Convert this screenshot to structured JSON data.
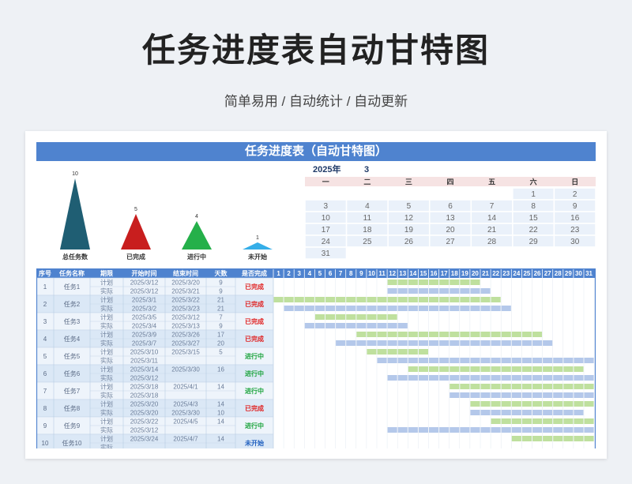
{
  "page": {
    "title": "任务进度表自动甘特图",
    "subtitle": "简单易用 / 自动统计 / 自动更新",
    "banner": "任务进度表（自动甘特图）"
  },
  "colors": {
    "banner": "#4f83cf",
    "table_header": "#4f83cf",
    "plan_bar": "#bfe09e",
    "actual_bar": "#b4c8ea",
    "status_done": "#e02020",
    "status_doing": "#1aa33b",
    "status_notstarted": "#1f5fbf"
  },
  "chart_data": {
    "type": "bar",
    "categories": [
      "总任务数",
      "已完成",
      "进行中",
      "未开始"
    ],
    "values": [
      10,
      5,
      4,
      1
    ],
    "colors": [
      "#1f5e73",
      "#c81e1e",
      "#25b04a",
      "#35aee8"
    ],
    "ylim": [
      0,
      10
    ],
    "shape": "triangle"
  },
  "calendar": {
    "year_label": "2025年",
    "month_label": "3",
    "weekdays": [
      "一",
      "二",
      "三",
      "四",
      "五",
      "六",
      "日"
    ],
    "weeks": [
      [
        "",
        "",
        "",
        "",
        "",
        "1",
        "2"
      ],
      [
        "3",
        "4",
        "5",
        "6",
        "7",
        "8",
        "9"
      ],
      [
        "10",
        "11",
        "12",
        "13",
        "14",
        "15",
        "16"
      ],
      [
        "17",
        "18",
        "19",
        "20",
        "21",
        "22",
        "23"
      ],
      [
        "24",
        "25",
        "26",
        "27",
        "28",
        "29",
        "30"
      ],
      [
        "31",
        "",
        "",
        "",
        "",
        "",
        ""
      ]
    ]
  },
  "table": {
    "headers": [
      "序号",
      "任务名称",
      "期限",
      "开始时间",
      "结束时间",
      "天数",
      "是否完成"
    ],
    "plan_label": "计划",
    "actual_label": "实际",
    "day_count": 31,
    "tasks": [
      {
        "seq": "1",
        "name": "任务1",
        "plan": [
          "2025/3/12",
          "2025/3/20",
          "9"
        ],
        "actual": [
          "2025/3/12",
          "2025/3/21",
          "9"
        ],
        "status": "已完成",
        "status_type": "done"
      },
      {
        "seq": "2",
        "name": "任务2",
        "plan": [
          "2025/3/1",
          "2025/3/22",
          "21"
        ],
        "actual": [
          "2025/3/2",
          "2025/3/23",
          "21"
        ],
        "status": "已完成",
        "status_type": "done"
      },
      {
        "seq": "3",
        "name": "任务3",
        "plan": [
          "2025/3/5",
          "2025/3/12",
          "7"
        ],
        "actual": [
          "2025/3/4",
          "2025/3/13",
          "9"
        ],
        "status": "已完成",
        "status_type": "done"
      },
      {
        "seq": "4",
        "name": "任务4",
        "plan": [
          "2025/3/9",
          "2025/3/26",
          "17"
        ],
        "actual": [
          "2025/3/7",
          "2025/3/27",
          "20"
        ],
        "status": "已完成",
        "status_type": "done"
      },
      {
        "seq": "5",
        "name": "任务5",
        "plan": [
          "2025/3/10",
          "2025/3/15",
          "5"
        ],
        "actual": [
          "2025/3/11",
          "",
          ""
        ],
        "status": "进行中",
        "status_type": "doing"
      },
      {
        "seq": "6",
        "name": "任务6",
        "plan": [
          "2025/3/14",
          "2025/3/30",
          "16"
        ],
        "actual": [
          "2025/3/12",
          "",
          ""
        ],
        "status": "进行中",
        "status_type": "doing"
      },
      {
        "seq": "7",
        "name": "任务7",
        "plan": [
          "2025/3/18",
          "2025/4/1",
          "14"
        ],
        "actual": [
          "2025/3/18",
          "",
          ""
        ],
        "status": "进行中",
        "status_type": "doing"
      },
      {
        "seq": "8",
        "name": "任务8",
        "plan": [
          "2025/3/20",
          "2025/4/3",
          "14"
        ],
        "actual": [
          "2025/3/20",
          "2025/3/30",
          "10"
        ],
        "status": "已完成",
        "status_type": "done"
      },
      {
        "seq": "9",
        "name": "任务9",
        "plan": [
          "2025/3/22",
          "2025/4/5",
          "14"
        ],
        "actual": [
          "2025/3/12",
          "",
          ""
        ],
        "status": "进行中",
        "status_type": "doing"
      },
      {
        "seq": "10",
        "name": "任务10",
        "plan": [
          "2025/3/24",
          "2025/4/7",
          "14"
        ],
        "actual": [
          "",
          "",
          ""
        ],
        "status": "未开始",
        "status_type": "notstarted"
      }
    ]
  }
}
